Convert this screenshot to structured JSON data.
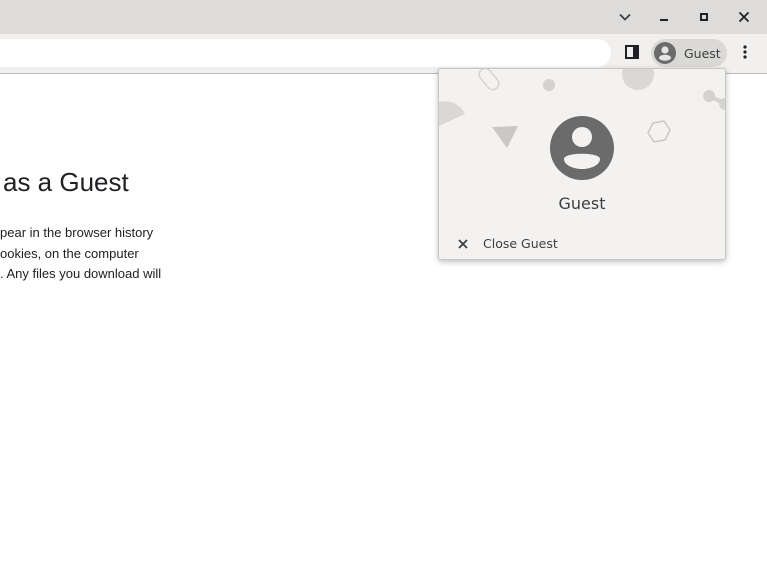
{
  "window": {
    "controls": [
      "chevron-down-icon",
      "minimize-icon",
      "maximize-icon",
      "close-icon"
    ]
  },
  "toolbar": {
    "side_panel_icon": "side-panel-icon",
    "profile_chip_label": "Guest",
    "menu_icon": "more-vert-icon"
  },
  "page": {
    "heading": "as a Guest",
    "lines": [
      "pear in the browser history",
      "ookies, on the computer",
      ". Any files you download will"
    ]
  },
  "profile_popup": {
    "name": "Guest",
    "close_label": "Close Guest"
  },
  "colors": {
    "titlebar": "#dedcda",
    "toolbar": "#f1f0ee",
    "popup_bg": "#f3f2f0",
    "avatar": "#6b6b6b"
  }
}
